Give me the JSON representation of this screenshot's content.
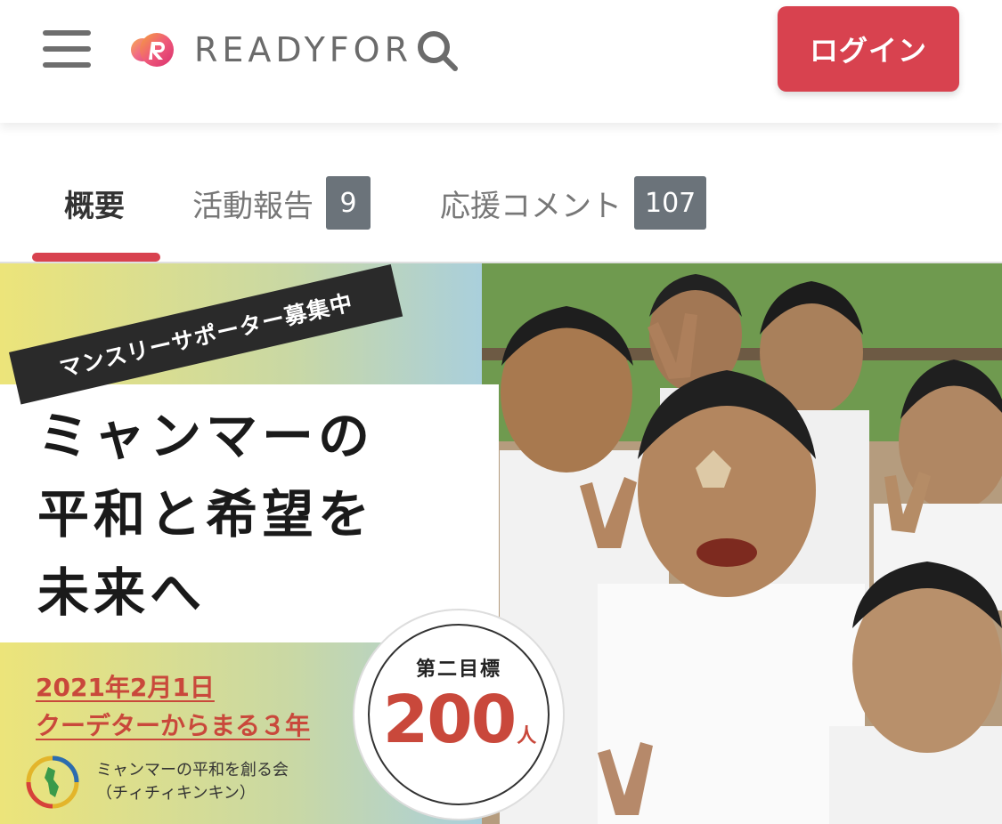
{
  "header": {
    "logo_text": "READYFOR",
    "login_label": "ログイン"
  },
  "tabs": [
    {
      "label": "概要",
      "badge": null,
      "active": true
    },
    {
      "label": "活動報告",
      "badge": "9",
      "active": false
    },
    {
      "label": "応援コメント",
      "badge": "107",
      "active": false
    }
  ],
  "banner": {
    "recruit_tag": "マンスリーサポーター募集中",
    "headline": [
      "ミャンマーの",
      "平和と希望を",
      "未来へ"
    ],
    "date_line1": "2021年2月1日",
    "date_line2": "クーデターからまる３年",
    "goal_label": "第二目標",
    "goal_number": "200",
    "goal_unit": "人",
    "org_name_line1": "ミャンマーの平和を創る会",
    "org_name_line2": "（チィチィキンキン）"
  },
  "colors": {
    "accent": "#d8424f",
    "goal_red": "#c9483b",
    "badge_gray": "#6b737a"
  }
}
